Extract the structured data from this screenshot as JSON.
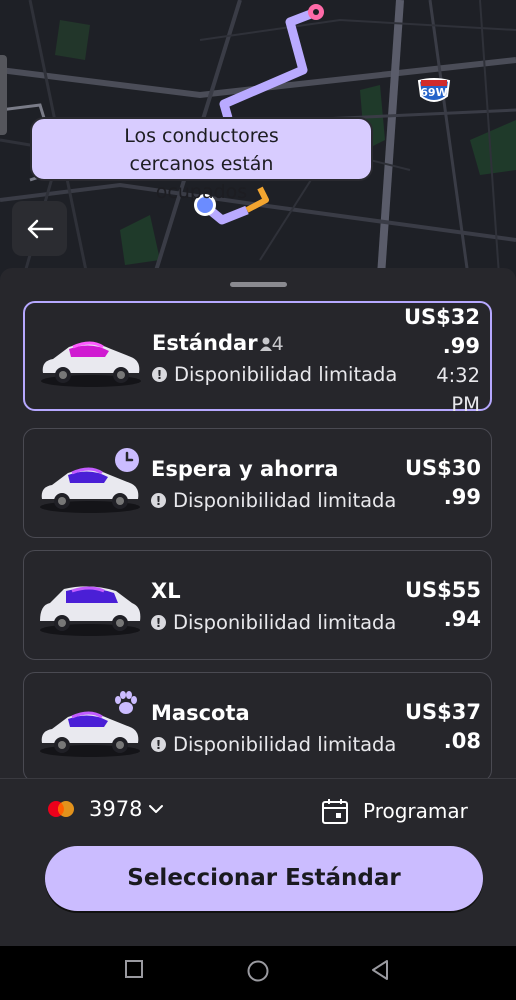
{
  "map": {
    "highway_shield": "69W",
    "banner": "Los conductores cercanos están ocupados",
    "colors": {
      "route": "#b9aaff",
      "origin_pin": "#ff6aa8",
      "user_dot": "#6b8cff",
      "eta_segment": "#f2a530"
    }
  },
  "back_button": {
    "icon": "arrow-left-icon"
  },
  "rides": [
    {
      "name": "Estándar",
      "passengers": "4",
      "availability": "Disponibilidad limitada",
      "price_line1": "US$32",
      "price_line2": ".99",
      "time_line1": "4:32",
      "time_line2": "PM",
      "selected": true,
      "badge": ""
    },
    {
      "name": "Espera y ahorra",
      "passengers": "",
      "availability": "Disponibilidad limitada",
      "price_line1": "US$30",
      "price_line2": ".99",
      "selected": false,
      "badge": "clock-icon"
    },
    {
      "name": "XL",
      "passengers": "",
      "availability": "Disponibilidad limitada",
      "price_line1": "US$55",
      "price_line2": ".94",
      "selected": false,
      "badge": ""
    },
    {
      "name": "Mascota",
      "passengers": "",
      "availability": "Disponibilidad limitada",
      "price_line1": "US$37",
      "price_line2": ".08",
      "selected": false,
      "badge": "paw-icon"
    }
  ],
  "payment": {
    "card_last4": "3978",
    "icon": "mastercard-icon"
  },
  "schedule": {
    "label": "Programar",
    "icon": "calendar-icon"
  },
  "cta": {
    "label": "Seleccionar Estándar"
  },
  "navbar": {
    "buttons": [
      "recents-square-icon",
      "home-circle-icon",
      "back-triangle-icon"
    ]
  }
}
